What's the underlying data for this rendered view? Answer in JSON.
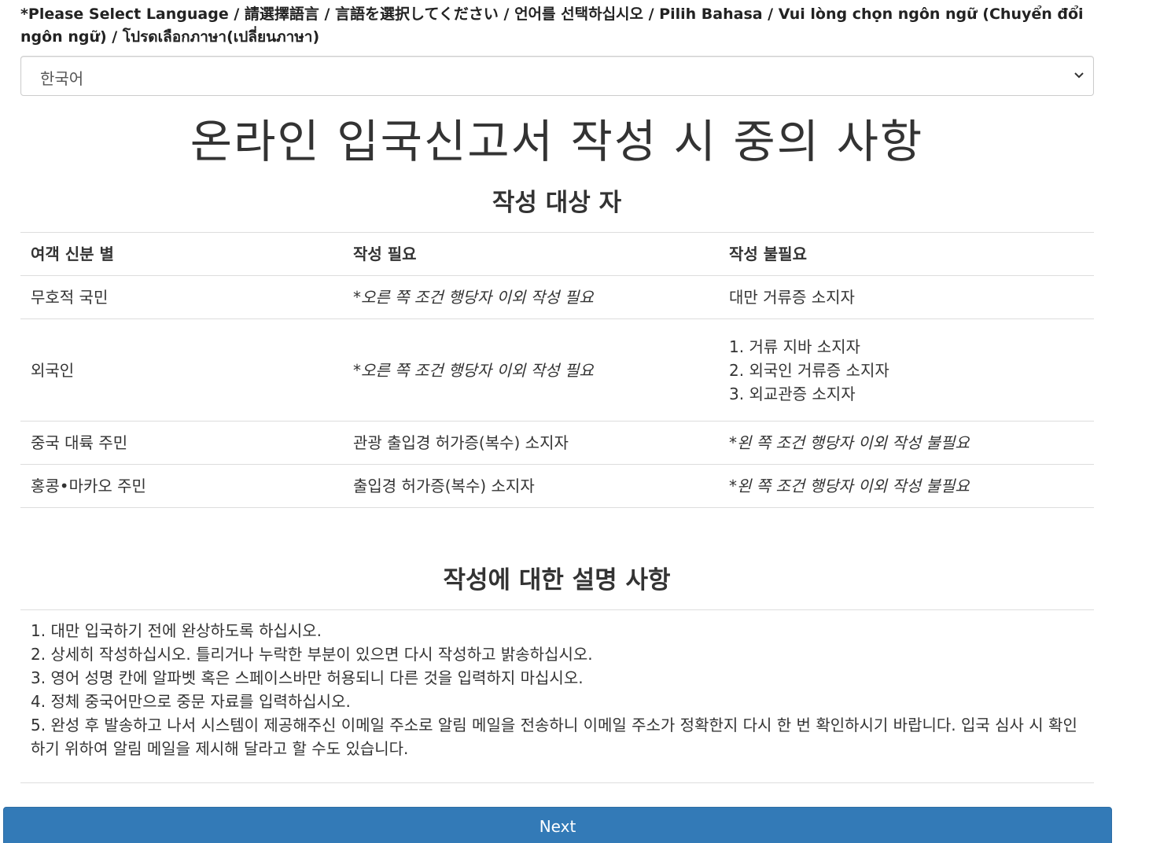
{
  "language": {
    "label": "*Please Select Language / 請選擇語言 / 言語を選択してください / 언어를 선택하십시오 / Pilih Bahasa / Vui lòng chọn ngôn ngữ (Chuyển đổi ngôn ngữ) / โปรดเลือกภาษา(เปลี่ยนภาษา)",
    "selected": "한국어"
  },
  "main_title": "온라인 입국신고서 작성 시 중의 사항",
  "section1": {
    "title": "작성 대상 자",
    "headers": [
      "여객 신분 별",
      "작성 필요",
      "작성 불필요"
    ],
    "rows": [
      {
        "identity": "무호적 국민",
        "required": "*오른 쪽 조건 행당자 이외 작성 필요",
        "not_required": "대만 거류증 소지자"
      },
      {
        "identity": "외국인",
        "required": "*오른 쪽 조건 행당자 이외 작성 필요",
        "not_required_list": [
          "1. 거류 지바 소지자",
          "2. 외국인 거류증 소지자",
          "3. 외교관증 소지자"
        ]
      },
      {
        "identity": "중국 대륙 주민",
        "required": "관광 출입경 허가증(복수) 소지자",
        "not_required": "*왼 쪽 조건 행당자 이외 작성 불필요"
      },
      {
        "identity": "홍콩•마카오 주민",
        "required": "출입경 허가증(복수) 소지자",
        "not_required": "*왼 쪽 조건 행당자 이외 작성 불필요"
      }
    ]
  },
  "section2": {
    "title": "작성에 대한 설명 사항",
    "items": [
      "1. 대만 입국하기 전에 완상하도록 하십시오.",
      "2. 상세히 작성하십시오. 틀리거나 누락한 부분이 있으면 다시 작성하고 밝송하십시오.",
      "3. 영어 성명 칸에 알파벳 혹은 스페이스바만 허용되니 다른 것을 입력하지 마십시오.",
      "4. 정체 중국어만으로 중문 자료를 입력하십시오.",
      "5. 완성 후 발송하고 나서 시스템이 제공해주신 이메일 주소로 알림 메일을 전송하니 이메일 주소가 정확한지 다시 한 번 확인하시기 바랍니다. 입국 심사 시 확인하기 위하여 알림 메일을 제시해 달라고 할 수도 있습니다."
    ]
  },
  "next_button": "Next",
  "colors": {
    "note_text": "#0000ee",
    "button_bg": "#337ab7"
  }
}
